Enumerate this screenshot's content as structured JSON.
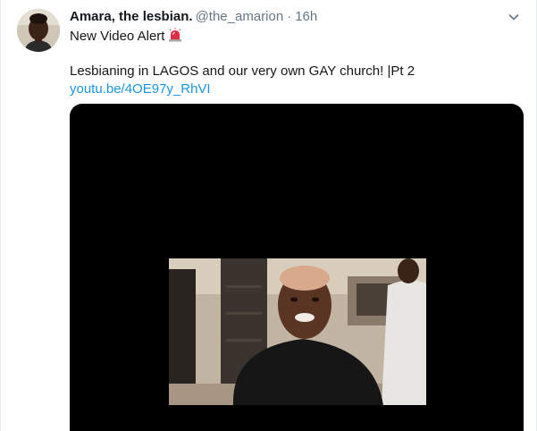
{
  "tweet": {
    "display_name": "Amara, the lesbian.",
    "handle": "@the_amarion",
    "separator": "·",
    "time": "16h",
    "line1": "New Video Alert",
    "line1_emoji": "police-car-light-emoji",
    "line2": "Lesbianing in LAGOS and our very own GAY church! |Pt 2",
    "link": "youtu.be/4OE97y_RhVI"
  },
  "colors": {
    "text": "#14171a",
    "muted": "#657786",
    "link": "#1b95e0",
    "media_bg": "#000000"
  },
  "icons": {
    "caret": "chevron-down-icon"
  }
}
